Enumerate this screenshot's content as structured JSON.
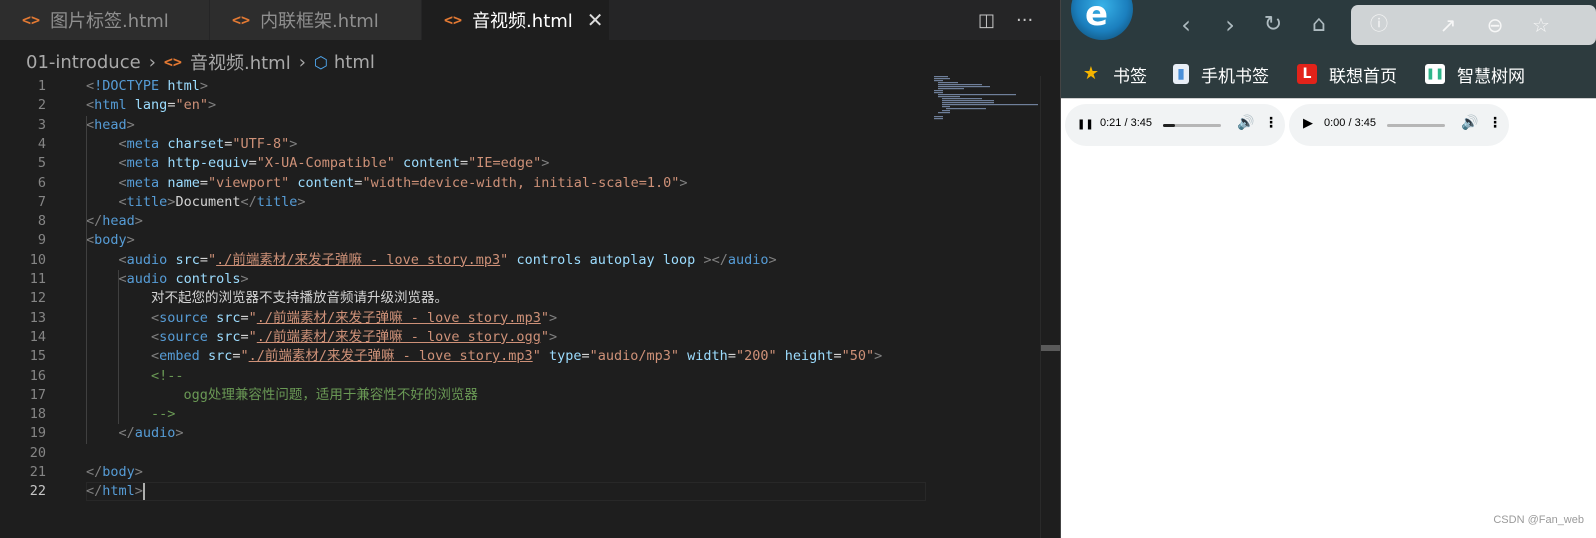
{
  "editor": {
    "tabs": [
      {
        "icon": "<>",
        "label": "图片标签.html"
      },
      {
        "icon": "<>",
        "label": "内联框架.html"
      },
      {
        "icon": "<>",
        "label": "音视频.html",
        "close": "✕"
      }
    ],
    "actions": {
      "split": "◫",
      "more": "···"
    },
    "breadcrumb": {
      "folder": "01-introduce",
      "file_icon": "<>",
      "file": "音视频.html",
      "element_icon": "⬡",
      "element": "html"
    },
    "lines": [
      {
        "n": "1",
        "html": "<span style='color:#808080'>&lt;</span><span style='color:#569cd6'>!DOCTYPE</span> <span style='color:#9cdcfe'>html</span><span style='color:#808080'>&gt;</span>"
      },
      {
        "n": "2",
        "html": "<span style='color:#808080'>&lt;</span><span style='color:#569cd6'>html</span> <span style='color:#9cdcfe'>lang</span>=<span style='color:#ce9178'>\"en\"</span><span style='color:#808080'>&gt;</span>"
      },
      {
        "n": "3",
        "html": "<span style='color:#808080'>&lt;</span><span style='color:#569cd6'>head</span><span style='color:#808080'>&gt;</span>"
      },
      {
        "n": "4",
        "html": "    <span style='color:#808080'>&lt;</span><span style='color:#569cd6'>meta</span> <span style='color:#9cdcfe'>charset</span>=<span style='color:#ce9178'>\"UTF-8\"</span><span style='color:#808080'>&gt;</span>"
      },
      {
        "n": "5",
        "html": "    <span style='color:#808080'>&lt;</span><span style='color:#569cd6'>meta</span> <span style='color:#9cdcfe'>http-equiv</span>=<span style='color:#ce9178'>\"X-UA-Compatible\"</span> <span style='color:#9cdcfe'>content</span>=<span style='color:#ce9178'>\"IE=edge\"</span><span style='color:#808080'>&gt;</span>"
      },
      {
        "n": "6",
        "html": "    <span style='color:#808080'>&lt;</span><span style='color:#569cd6'>meta</span> <span style='color:#9cdcfe'>name</span>=<span style='color:#ce9178'>\"viewport\"</span> <span style='color:#9cdcfe'>content</span>=<span style='color:#ce9178'>\"width=device-width, initial-scale=1.0\"</span><span style='color:#808080'>&gt;</span>"
      },
      {
        "n": "7",
        "html": "    <span style='color:#808080'>&lt;</span><span style='color:#569cd6'>title</span><span style='color:#808080'>&gt;</span>Document<span style='color:#808080'>&lt;/</span><span style='color:#569cd6'>title</span><span style='color:#808080'>&gt;</span>"
      },
      {
        "n": "8",
        "html": "<span style='color:#808080'>&lt;/</span><span style='color:#569cd6'>head</span><span style='color:#808080'>&gt;</span>"
      },
      {
        "n": "9",
        "html": "<span style='color:#808080'>&lt;</span><span style='color:#569cd6'>body</span><span style='color:#808080'>&gt;</span>"
      },
      {
        "n": "10",
        "html": "    <span style='color:#808080'>&lt;</span><span style='color:#569cd6'>audio</span> <span style='color:#9cdcfe'>src</span>=<span style='color:#ce9178'>\"<u>./前端素材/来发子弹嘛 - love story.mp3</u>\"</span> <span style='color:#9cdcfe'>controls</span> <span style='color:#9cdcfe'>autoplay</span> <span style='color:#9cdcfe'>loop</span> <span style='color:#808080'>&gt;&lt;/</span><span style='color:#569cd6'>audio</span><span style='color:#808080'>&gt;</span>"
      },
      {
        "n": "11",
        "html": "    <span style='color:#808080'>&lt;</span><span style='color:#569cd6'>audio</span> <span style='color:#9cdcfe'>controls</span><span style='color:#808080'>&gt;</span>"
      },
      {
        "n": "12",
        "html": "        对不起您的浏览器不支持播放音频请升级浏览器。"
      },
      {
        "n": "13",
        "html": "        <span style='color:#808080'>&lt;</span><span style='color:#569cd6'>source</span> <span style='color:#9cdcfe'>src</span>=<span style='color:#ce9178'>\"<u>./前端素材/来发子弹嘛 - love story.mp3</u>\"</span><span style='color:#808080'>&gt;</span>"
      },
      {
        "n": "14",
        "html": "        <span style='color:#808080'>&lt;</span><span style='color:#569cd6'>source</span> <span style='color:#9cdcfe'>src</span>=<span style='color:#ce9178'>\"<u>./前端素材/来发子弹嘛 - love story.ogg</u>\"</span><span style='color:#808080'>&gt;</span>"
      },
      {
        "n": "15",
        "html": "        <span style='color:#808080'>&lt;</span><span style='color:#569cd6'>embed</span> <span style='color:#9cdcfe'>src</span>=<span style='color:#ce9178'>\"<u>./前端素材/来发子弹嘛 - love story.mp3</u>\"</span> <span style='color:#9cdcfe'>type</span>=<span style='color:#ce9178'>\"audio/mp3\"</span> <span style='color:#9cdcfe'>width</span>=<span style='color:#ce9178'>\"200\"</span> <span style='color:#9cdcfe'>height</span>=<span style='color:#ce9178'>\"50\"</span><span style='color:#808080'>&gt;</span>"
      },
      {
        "n": "16",
        "html": "        <span style='color:#6a9955'>&lt;!--</span>"
      },
      {
        "n": "17",
        "html": "            <span style='color:#6a9955'>ogg处理兼容性问题，适用于兼容性不好的浏览器</span>"
      },
      {
        "n": "18",
        "html": "        <span style='color:#6a9955'>--&gt;</span>"
      },
      {
        "n": "19",
        "html": "    <span style='color:#808080'>&lt;/</span><span style='color:#569cd6'>audio</span><span style='color:#808080'>&gt;</span>"
      },
      {
        "n": "20",
        "html": ""
      },
      {
        "n": "21",
        "html": "<span style='color:#808080'>&lt;/</span><span style='color:#569cd6'>body</span><span style='color:#808080'>&gt;</span>"
      },
      {
        "n": "22",
        "html": "<span style='color:#808080'>&lt;/</span><span style='color:#569cd6'>html</span><span style='color:#808080'>&gt;</span><span class='cursor'></span>"
      }
    ],
    "current_line": "22"
  },
  "browser": {
    "logo": "e",
    "nav": {
      "back": "‹",
      "forward": "›",
      "refresh": "↻",
      "home": "⌂"
    },
    "address_icons": {
      "info": "ⓘ",
      "share": "↗",
      "zoom": "⊖",
      "favorite": "☆"
    },
    "bookmarks": [
      {
        "label": "书签",
        "icon": "★",
        "color": "#f5b400"
      },
      {
        "label": "手机书签",
        "icon": "▮",
        "color": "#4a90d9"
      },
      {
        "label": "联想首页",
        "icon": "L",
        "color": "#e2231a"
      },
      {
        "label": "智慧树网",
        "icon": "❚❚",
        "color": "#ffffff"
      }
    ],
    "players": [
      {
        "state": "playing",
        "button": "❚❚",
        "time": "0:21 / 3:45",
        "progress": 0.2,
        "volume_icon": "🔊",
        "menu": "⋮"
      },
      {
        "state": "paused",
        "button": "▶",
        "time": "0:00 / 3:45",
        "progress": 0.0,
        "volume_icon": "🔊",
        "menu": "⋮"
      }
    ],
    "watermark": "CSDN @Fan_web"
  }
}
